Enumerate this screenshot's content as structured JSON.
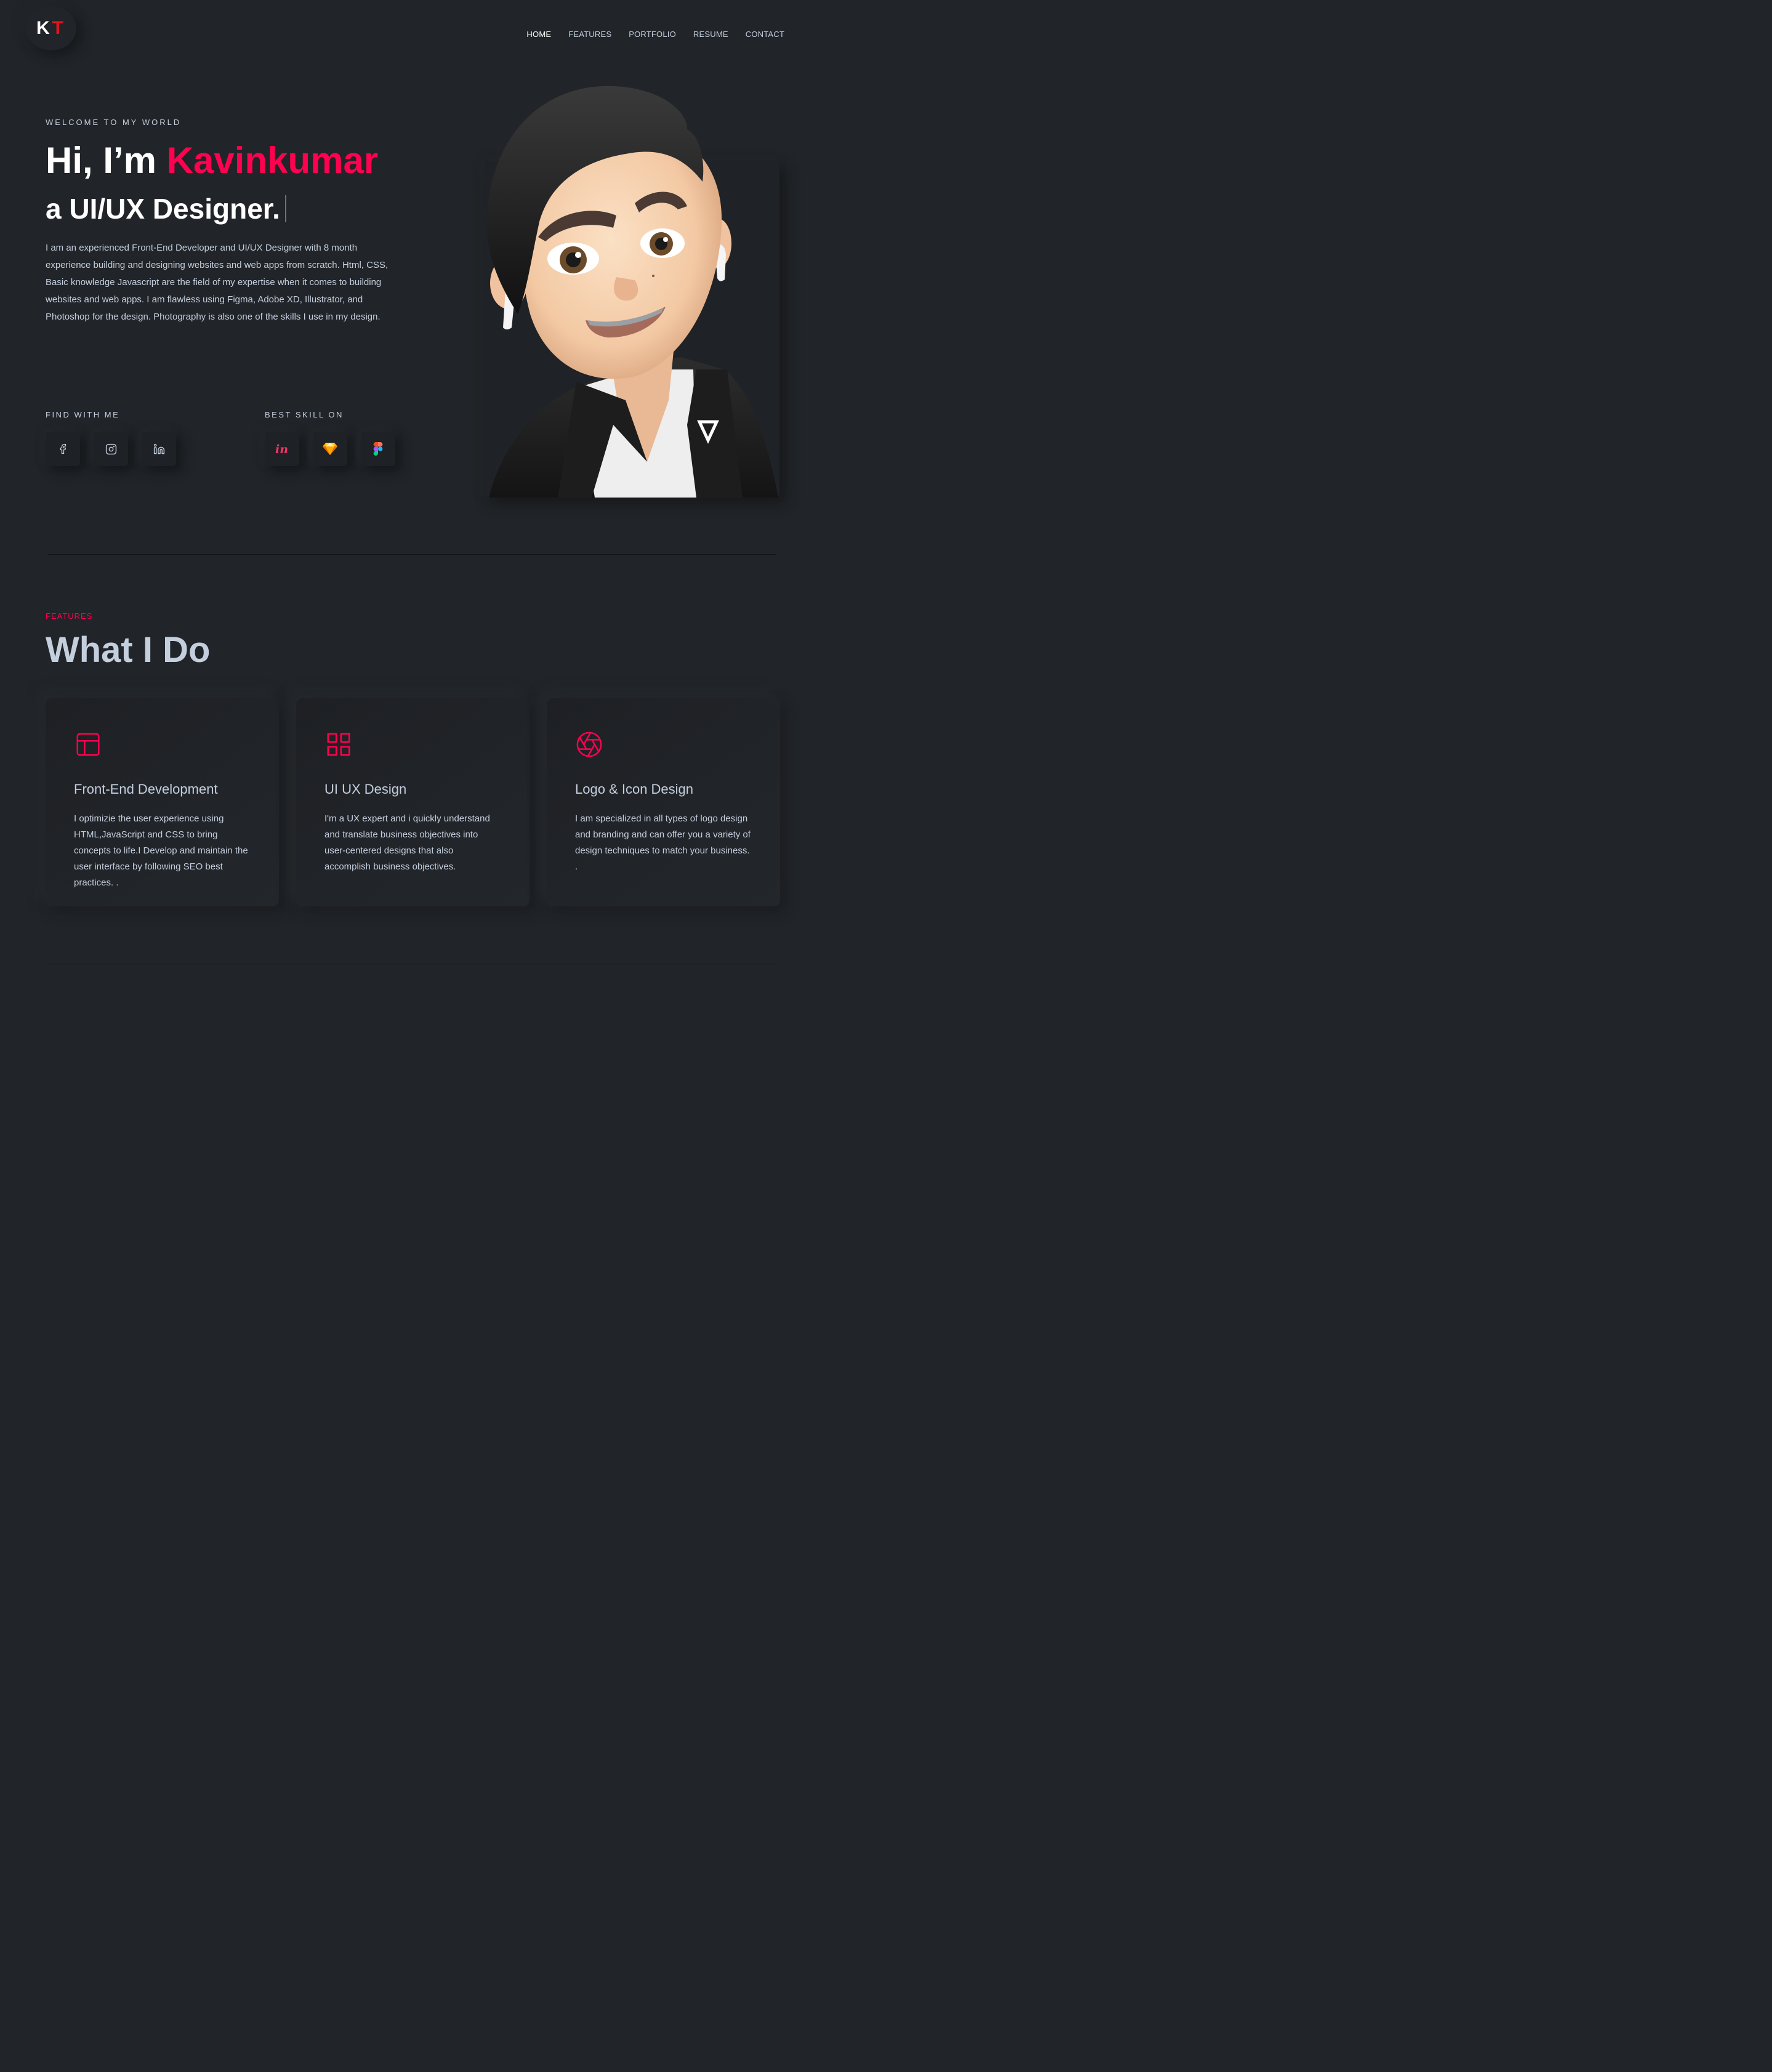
{
  "header": {
    "logo_k": "K",
    "logo_t": "T",
    "nav": [
      "HOME",
      "FEATURES",
      "PORTFOLIO",
      "RESUME",
      "CONTACT"
    ]
  },
  "hero": {
    "welcome": "WELCOME TO MY WORLD",
    "greeting": "Hi, I’m ",
    "name": "Kavinkumar",
    "role": "a UI/UX Designer.",
    "intro": "I am an experienced Front-End Developer and UI/UX Designer with 8 month experience building and designing websites and web apps from scratch. Html, CSS, Basic knowledge Javascript are the field of my expertise when it comes to building websites and web apps. I am flawless using Figma, Adobe XD, Illustrator, and Photoshop for the design. Photography is also one of the skills I use in my design.",
    "find_label": "FIND WITH ME",
    "skill_label": "BEST SKILL ON",
    "social_icons": [
      "facebook-icon",
      "instagram-icon",
      "linkedin-icon"
    ],
    "skill_icons": [
      "invision-icon",
      "sketch-icon",
      "figma-icon"
    ]
  },
  "features": {
    "label": "FEATURES",
    "title": "What I Do",
    "cards": [
      {
        "icon": "layout-icon",
        "title": "Front-End Development",
        "text": "I optimizie the user experience using HTML,JavaScript and CSS to bring concepts to life.I Develop and maintain the user interface by following SEO best practices. ."
      },
      {
        "icon": "grid-icon",
        "title": "UI UX Design",
        "text": "I'm a UX expert and i quickly understand and translate business objectives into user-centered designs that also accomplish business objectives."
      },
      {
        "icon": "aperture-icon",
        "title": "Logo & Icon Design",
        "text": "I am specialized in all types of logo design and branding and can offer you a variety of design techniques to match your business. ."
      }
    ]
  },
  "colors": {
    "background": "#212428",
    "accent": "#ff014f",
    "text": "#c4cfde",
    "logo_t": "#e1141f"
  }
}
